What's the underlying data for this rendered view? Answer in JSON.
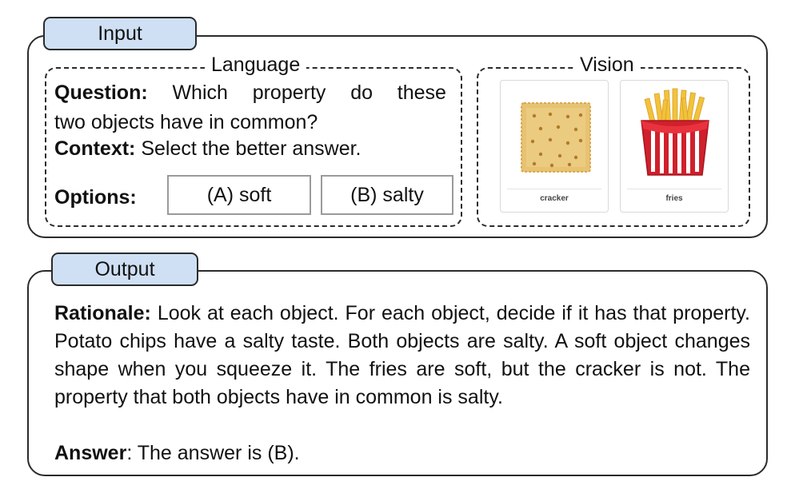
{
  "input": {
    "tab_label": "Input",
    "language": {
      "title": "Language",
      "question_label": "Question:",
      "question_line1_words": [
        "Which",
        "property",
        "do",
        "these"
      ],
      "question_line2": "two objects have in common?",
      "context_label": "Context:",
      "context_text": "Select the better answer.",
      "options_label": "Options:",
      "option_a": "(A) soft",
      "option_b": "(B) salty"
    },
    "vision": {
      "title": "Vision",
      "cards": [
        {
          "caption": "cracker",
          "icon": "cracker-image"
        },
        {
          "caption": "fries",
          "icon": "fries-image"
        }
      ]
    }
  },
  "output": {
    "tab_label": "Output",
    "rationale_label": "Rationale:",
    "rationale_text": "Look at each object. For each object, decide if it has that property. Potato chips have a salty taste. Both objects are salty. A soft object changes shape when you squeeze it. The fries are soft, but the cracker is not. The property that both objects have in common is salty.",
    "answer_label": "Answer",
    "answer_text": ": The answer is (B)."
  },
  "colors": {
    "tab_fill": "#cfe0f4",
    "border": "#2b2b2b",
    "cracker": "#e7c272",
    "fries_box": "#d0202b",
    "fries": "#f2c23a"
  }
}
